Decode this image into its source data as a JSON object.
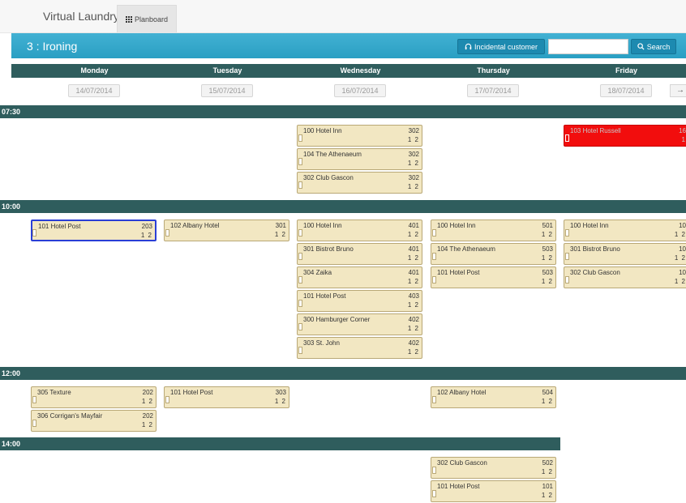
{
  "nav": {
    "brand": "Virtual Laundry",
    "tab_label": "Planboard"
  },
  "title": "3 : Ironing",
  "actions": {
    "incidental_label": "Incidental customer",
    "search_placeholder": "",
    "search_label": "Search"
  },
  "days": [
    {
      "name": "Monday",
      "date": "14/07/2014"
    },
    {
      "name": "Tuesday",
      "date": "15/07/2014"
    },
    {
      "name": "Wednesday",
      "date": "16/07/2014"
    },
    {
      "name": "Thursday",
      "date": "17/07/2014"
    },
    {
      "name": "Friday",
      "date": "18/07/2014"
    }
  ],
  "next_arrow": "→",
  "slots": [
    {
      "time": "07:30",
      "columns": [
        [],
        [],
        [
          {
            "name": "100 Hotel Inn",
            "num": "302",
            "qty": "1 2"
          },
          {
            "name": "104 The Athenaeum",
            "num": "302",
            "qty": "1 2"
          },
          {
            "name": "302 Club Gascon",
            "num": "302",
            "qty": "1 2"
          }
        ],
        [],
        [
          {
            "name": "103 Hotel Russell",
            "num": "16",
            "qty": "1",
            "alert": true
          }
        ]
      ]
    },
    {
      "time": "10:00",
      "columns": [
        [
          {
            "name": "101 Hotel Post",
            "num": "203",
            "qty": "1 2",
            "selected": true
          }
        ],
        [
          {
            "name": "102 Albany Hotel",
            "num": "301",
            "qty": "1 2"
          }
        ],
        [
          {
            "name": "100 Hotel Inn",
            "num": "401",
            "qty": "1 2"
          },
          {
            "name": "301 Bistrot Bruno",
            "num": "401",
            "qty": "1 2"
          },
          {
            "name": "304 Zaika",
            "num": "401",
            "qty": "1 2"
          },
          {
            "name": "101 Hotel Post",
            "num": "403",
            "qty": "1 2"
          },
          {
            "name": "300 Hamburger Corner",
            "num": "402",
            "qty": "1 2"
          },
          {
            "name": "303 St. John",
            "num": "402",
            "qty": "1 2"
          }
        ],
        [
          {
            "name": "100 Hotel Inn",
            "num": "501",
            "qty": "1 2"
          },
          {
            "name": "104 The Athenaeum",
            "num": "503",
            "qty": "1 2"
          },
          {
            "name": "101 Hotel Post",
            "num": "503",
            "qty": "1 2"
          }
        ],
        [
          {
            "name": "100 Hotel Inn",
            "num": "10",
            "qty": "1 2"
          },
          {
            "name": "301 Bistrot Bruno",
            "num": "10",
            "qty": "1 2"
          },
          {
            "name": "302 Club Gascon",
            "num": "10",
            "qty": "1 2"
          }
        ]
      ]
    },
    {
      "time": "12:00",
      "columns": [
        [
          {
            "name": "305 Texture",
            "num": "202",
            "qty": "1 2"
          },
          {
            "name": "306 Corrigan's Mayfair",
            "num": "202",
            "qty": "1 2"
          }
        ],
        [
          {
            "name": "101 Hotel Post",
            "num": "303",
            "qty": "1 2"
          }
        ],
        [],
        [
          {
            "name": "102 Albany Hotel",
            "num": "504",
            "qty": "1 2"
          }
        ],
        []
      ]
    },
    {
      "time": "14:00",
      "columns": [
        [],
        [],
        [],
        [
          {
            "name": "302 Club Gascon",
            "num": "502",
            "qty": "1 2"
          },
          {
            "name": "101 Hotel Post",
            "num": "101",
            "qty": "1 2"
          }
        ],
        []
      ]
    }
  ]
}
